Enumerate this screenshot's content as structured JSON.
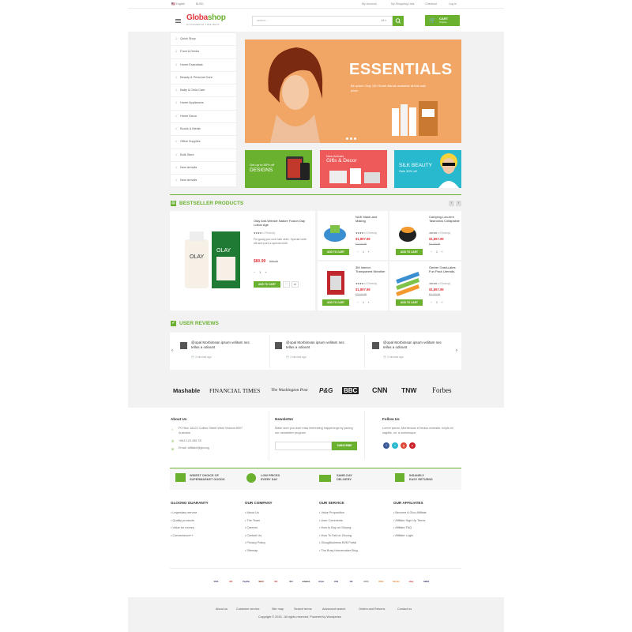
{
  "topbar": {
    "language": "English",
    "currency": "$USD",
    "my_account": "My Account",
    "shopping_lists": "My Shopping Lists",
    "checkout": "Checkout",
    "login": "Log In"
  },
  "header": {
    "logo_main": "Globa",
    "logo_accent": "shop",
    "tagline": "ECOMMERCE TIME BEST",
    "search_placeholder": "search ...",
    "search_category": "All",
    "cart_label": "CART",
    "cart_sub": "0 items"
  },
  "sidebar": {
    "items": [
      {
        "label": "Quick Shop"
      },
      {
        "label": "Food & Drinks"
      },
      {
        "label": "Home Essentials"
      },
      {
        "label": "Beauty & Personal Care"
      },
      {
        "label": "Baby & Child Care"
      },
      {
        "label": "Home Appliances"
      },
      {
        "label": "Home Decor"
      },
      {
        "label": "Books & Media"
      },
      {
        "label": "Office Supplies"
      },
      {
        "label": "Bulk Store"
      },
      {
        "label": "New Arrivals"
      },
      {
        "label": "New Arrivals"
      }
    ]
  },
  "hero": {
    "title": "ESSENTIALS",
    "text": "Be quick! Only 150 Smart Bands available at this sale price."
  },
  "banners": [
    {
      "line1": "Get up to 50% off",
      "line2": "DESIGNS",
      "color": "#6bb130"
    },
    {
      "line1": "New Arrivals",
      "line2": "Gifts & Decor",
      "color": "#ee5a5a"
    },
    {
      "line1": "SILK BEAUTY",
      "line2": "Sale 30% off",
      "color": "#29b9cf"
    }
  ],
  "bestseller": {
    "title": "BESTSELLER PRODUCTS",
    "featured": {
      "name": "Olay Anti-Wrinkle Nature Fusion Day Lotion Age",
      "reviews": "0 Review(s)",
      "desc": "Fin gusig you cruh talk cloth. Special cloth wit and pork a special cloth",
      "price": "$80.99",
      "old_price": "$99.99",
      "qty": "1",
      "add": "ADD TO CART"
    },
    "items": [
      {
        "name": "NUK Mash-and Making",
        "reviews": "0 Review(s)",
        "price": "$1,897.99",
        "old_price": "$2,100.99",
        "qty": "1",
        "add": "ADD TO CART"
      },
      {
        "name": "Camping Lan-tern Tastronics Collapsible",
        "reviews": "0 Review(s)",
        "price": "$1,897.99",
        "old_price": "$2,100.99",
        "qty": "1",
        "add": "ADD TO CART"
      },
      {
        "name": "3M Interior Transparent Weather",
        "reviews": "0 Review(s)",
        "price": "$1,897.99",
        "old_price": "$2,100.99",
        "qty": "1",
        "add": "ADD TO CART"
      },
      {
        "name": "Gerber Gradu-ates Fun Pack Utensils,",
        "reviews": "0 Review(s)",
        "price": "$1,897.99",
        "old_price": "$2,100.99",
        "qty": "1",
        "add": "ADD TO CART"
      }
    ]
  },
  "reviews": {
    "title": "USER REVIEWS",
    "items": [
      {
        "text": "@opal Morbimsan ipsum velitam nec tellus a odiount",
        "time": "3 minutes ago"
      },
      {
        "text": "@opal Morbimsan ipsum velitam nec tellus a odiount",
        "time": "3 minutes ago"
      },
      {
        "text": "@opal Morbimsan ipsum velitam nec tellus a odiount",
        "time": "3 minutes ago"
      }
    ]
  },
  "brands": [
    "Mashable",
    "FINANCIAL TIMES",
    "The Washington Post",
    "P&G",
    "BBC",
    "CNN",
    "TNW",
    "Forbes"
  ],
  "footer": {
    "about_title": "About Us",
    "address": "PO Box 16122 Collins Street West Victoria 8007 Australia",
    "phone": "+844 123 456 78",
    "email": "Email: affiliate@gloong",
    "newsletter_title": "Newsletter",
    "newsletter_text": "Make sure you dont miss interesting happenings by joining our newsletter program",
    "subscribe": "SUBSCRIBE",
    "follow_title": "Follow Us",
    "follow_text": "Lorem ipsum, Morbimsan et lectus molestie, turpis mi sagittis, mi. a scelerisque"
  },
  "features": [
    {
      "line1": "WIDEST CHOICE OF",
      "line2": "SUPERMARKET GOODS"
    },
    {
      "line1": "LOW PRICES",
      "line2": "EVERY DAY"
    },
    {
      "line1": "SAME-DAY",
      "line2": "DELIVERY"
    },
    {
      "line1": "INSANELY",
      "line2": "EASY RETURNS"
    }
  ],
  "link_columns": [
    {
      "title": "GLOONG GUARANTY",
      "links": [
        "Legendary service",
        "Quality products",
        "Value for money",
        "Convenience++"
      ]
    },
    {
      "title": "OUR COMPANY",
      "links": [
        "About Us",
        "The Team",
        "Careers",
        "Contact Us",
        "Privacy Policy",
        "Sitemap"
      ]
    },
    {
      "title": "OUR SERVICE",
      "links": [
        "Value Proposition",
        "User Comments",
        "How to Buy on Gloong",
        "How To Sell on Gloong",
        "GloogBusiness B2B Portal",
        "The Busy Homemaker Blog"
      ]
    },
    {
      "title": "OUR AFFILIATES",
      "links": [
        "Become A Gloo Affiliate",
        "Affiliate Sign Up Terms",
        "Affiliate FAQ",
        "Affiliate Login"
      ]
    }
  ],
  "payments": [
    "VISA",
    "MC",
    "PayPal",
    "Skrill",
    "MC",
    "WU",
    "amazon",
    "stripe",
    "JCB",
    "CB",
    "WIRE",
    "DISC",
    "bitcoin",
    "ebay",
    "AMEX"
  ],
  "bottom": {
    "links": [
      "About us",
      "Customer service",
      "Site map",
      "Search terms",
      "Advanced search",
      "Orders and Returns",
      "Contact us"
    ],
    "copyright": "Copyright © 2015 - All rights reserved. Powered by Wordpress"
  },
  "colors": {
    "accent": "#6bb130",
    "price": "#e0383e",
    "hero_bg": "#f2a665"
  }
}
